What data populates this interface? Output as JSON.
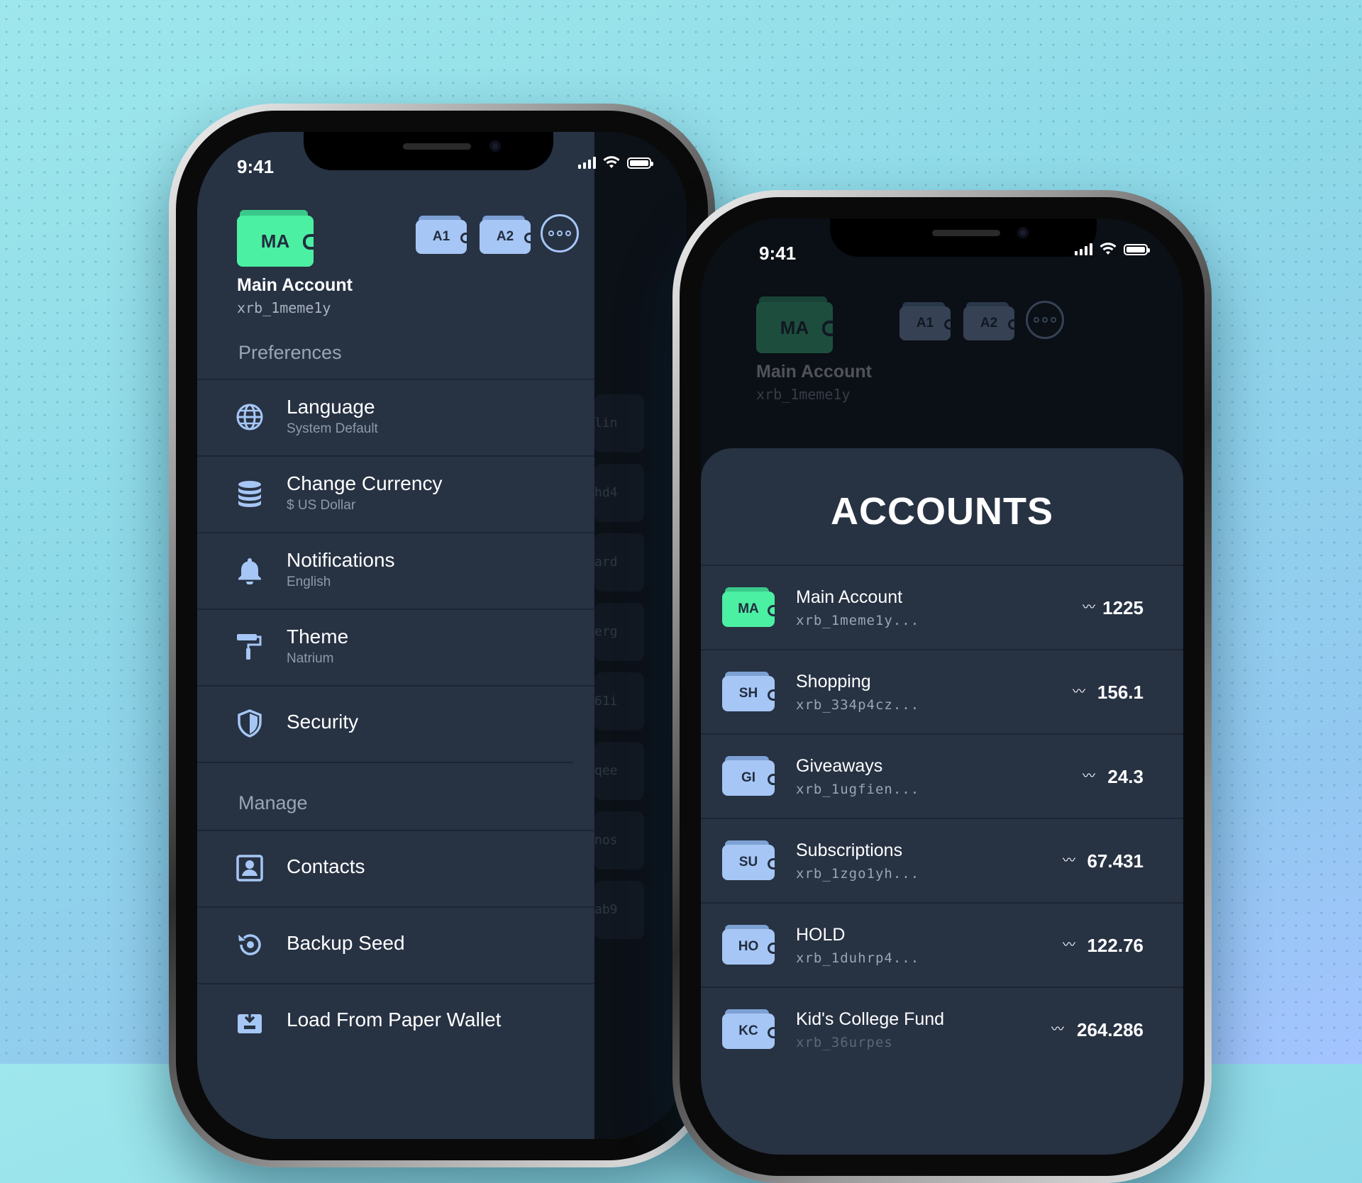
{
  "left_phone": {
    "status": {
      "time": "9:41"
    },
    "account": {
      "initials": "MA",
      "name": "Main Account",
      "address": "xrb_1meme1y"
    },
    "quick_accounts": [
      "A1",
      "A2"
    ],
    "preferences_title": "Preferences",
    "preferences": [
      {
        "label": "Language",
        "sub": "System Default",
        "icon": "globe-icon"
      },
      {
        "label": "Change Currency",
        "sub": "$ US Dollar",
        "icon": "coins-icon"
      },
      {
        "label": "Notifications",
        "sub": "English",
        "icon": "bell-icon"
      },
      {
        "label": "Theme",
        "sub": "Natrium",
        "icon": "paint-roller-icon"
      },
      {
        "label": "Security",
        "sub": "",
        "icon": "shield-icon"
      }
    ],
    "manage_title": "Manage",
    "manage": [
      {
        "label": "Contacts",
        "icon": "contact-card-icon"
      },
      {
        "label": "Backup Seed",
        "icon": "backup-icon"
      },
      {
        "label": "Load From Paper Wallet",
        "icon": "paper-wallet-icon"
      }
    ],
    "peek_texts": [
      "lin",
      "hd4",
      "ard",
      "erg",
      "61i",
      "qee",
      "nos",
      "ab9"
    ]
  },
  "right_phone": {
    "status": {
      "time": "9:41"
    },
    "background_account": {
      "initials": "MA",
      "name": "Main Account",
      "address": "xrb_1meme1y"
    },
    "quick_accounts": [
      "A1",
      "A2"
    ],
    "sheet_title": "ACCOUNTS",
    "accounts": [
      {
        "initials": "MA",
        "name": "Main Account",
        "address": "xrb_1meme1y...",
        "balance": "1225",
        "active": true
      },
      {
        "initials": "SH",
        "name": "Shopping",
        "address": "xrb_334p4cz...",
        "balance": "156.1",
        "active": false
      },
      {
        "initials": "GI",
        "name": "Giveaways",
        "address": "xrb_1ugfien...",
        "balance": "24.3",
        "active": false
      },
      {
        "initials": "SU",
        "name": "Subscriptions",
        "address": "xrb_1zgo1yh...",
        "balance": "67.431",
        "active": false
      },
      {
        "initials": "HO",
        "name": "HOLD",
        "address": "xrb_1duhrp4...",
        "balance": "122.76",
        "active": false
      },
      {
        "initials": "KC",
        "name": "Kid's College Fund",
        "address": "xrb_36urpes",
        "balance": "264.286",
        "active": false
      }
    ]
  },
  "colors": {
    "accent_green": "#4cf0a3",
    "accent_blue": "#a6c6f5",
    "panel": "#273243",
    "divider": "#1c2533"
  }
}
